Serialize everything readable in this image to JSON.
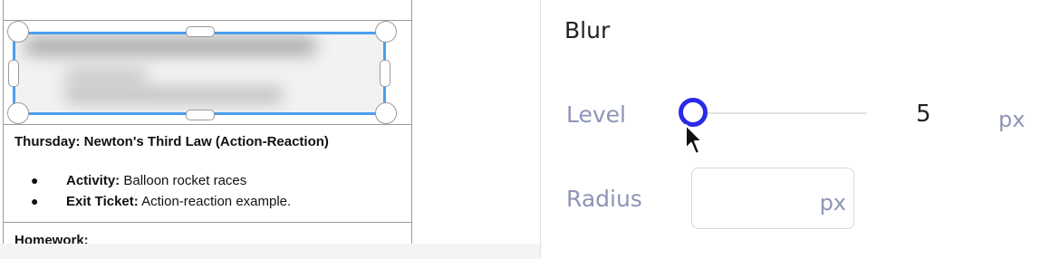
{
  "document": {
    "heading": "Thursday: Newton's Third Law (Action-Reaction)",
    "list_items": [
      {
        "bullet": "●",
        "label": "Activity:",
        "text": " Balloon rocket races"
      },
      {
        "bullet": "●",
        "label": "Exit Ticket:",
        "text": " Action-reaction example."
      }
    ],
    "footer_heading": "Homework:"
  },
  "panel": {
    "title": "Blur",
    "level": {
      "label": "Level",
      "value": "5",
      "unit": "px",
      "slider_fraction": 0.0
    },
    "radius": {
      "label": "Radius",
      "value": "",
      "unit": "px"
    }
  },
  "colors": {
    "selection": "#4a9ff0",
    "slider_thumb": "#2a2ae8",
    "label_muted": "#8e95b5"
  },
  "icons": {
    "cursor": "arrow-cursor-icon"
  }
}
